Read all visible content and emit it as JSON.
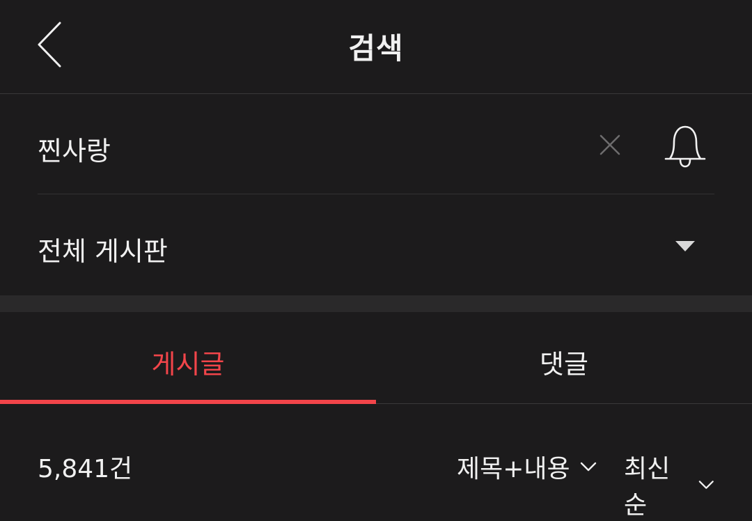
{
  "header": {
    "title": "검색",
    "back_icon": "chevron-left-icon"
  },
  "search": {
    "query": "찐사랑",
    "clear_icon": "close-icon",
    "alert_icon": "bell-icon"
  },
  "board_select": {
    "selected": "전체 게시판",
    "icon": "triangle-down-icon"
  },
  "tabs": [
    {
      "label": "게시글",
      "active": true
    },
    {
      "label": "댓글",
      "active": false
    }
  ],
  "results": {
    "count_label": "5,841건",
    "scope_filter": "제목+내용",
    "sort_filter": "최신순",
    "filter_icon": "chevron-down-icon"
  },
  "colors": {
    "background": "#1c1b1c",
    "accent": "#f2454a",
    "text": "#f1f1f1",
    "muted_icon": "#6d6c6d"
  }
}
